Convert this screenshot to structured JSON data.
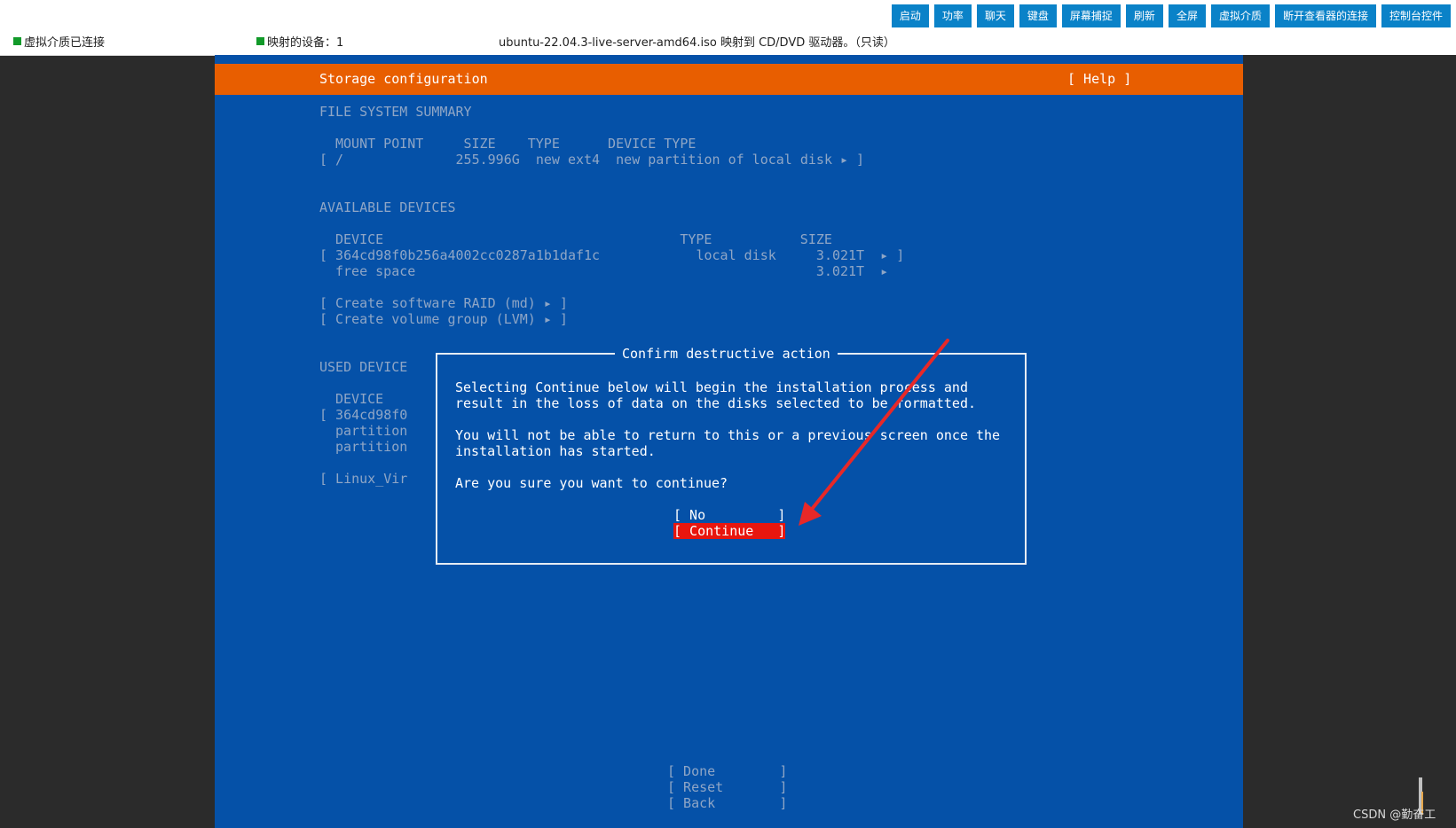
{
  "toolbar": {
    "buttons": [
      "启动",
      "功率",
      "聊天",
      "键盘",
      "屏幕捕捉",
      "刷新",
      "全屏",
      "虚拟介质",
      "断开查看器的连接",
      "控制台控件"
    ],
    "status_media": "虚拟介质已连接",
    "status_devices": "映射的设备：1",
    "status_iso": "ubuntu-22.04.3-live-server-amd64.iso 映射到 CD/DVD 驱动器。（只读）"
  },
  "screen": {
    "title": "Storage configuration",
    "help": "[ Help ]",
    "fs_summary_heading": "FILE SYSTEM SUMMARY",
    "fs_header": "MOUNT POINT     SIZE    TYPE      DEVICE TYPE",
    "fs_row": "[ /              255.996G  new ext4  new partition of local disk ▸ ]",
    "avail_heading": "AVAILABLE DEVICES",
    "avail_header": "DEVICE                                     TYPE           SIZE",
    "avail_row1": "[ 364cd98f0b256a4002cc0287a1b1daf1c            local disk     3.021T  ▸ ]",
    "avail_row2": "free space                                                  3.021T  ▸",
    "raid": "[ Create software RAID (md) ▸ ]",
    "lvm": "[ Create volume group (LVM) ▸ ]",
    "used_heading": "USED DEVICE",
    "used_header": "DEVICE",
    "used_row1": "[ 364cd98f0",
    "used_row2": "partition",
    "used_row3": "partition",
    "used_row4": "[ Linux_Vir",
    "done": "[ Done        ]",
    "reset": "[ Reset       ]",
    "back": "[ Back        ]"
  },
  "dialog": {
    "title": "Confirm destructive action",
    "line1": "Selecting Continue below will begin the installation process and",
    "line2": "result in the loss of data on the disks selected to be formatted.",
    "line3": "You will not be able to return to this or a previous screen once the",
    "line4": "installation has started.",
    "line5": "Are you sure you want to continue?",
    "no": "[ No         ]",
    "continue": "[ Continue   ]"
  },
  "colors": {
    "console_bg": "#0551a8",
    "title_bar": "#e85e00",
    "selected": "#e8160e",
    "arrow": "#e82828",
    "toolbar_button": "#0a82c8"
  },
  "watermark": "CSDN @勤奋工"
}
